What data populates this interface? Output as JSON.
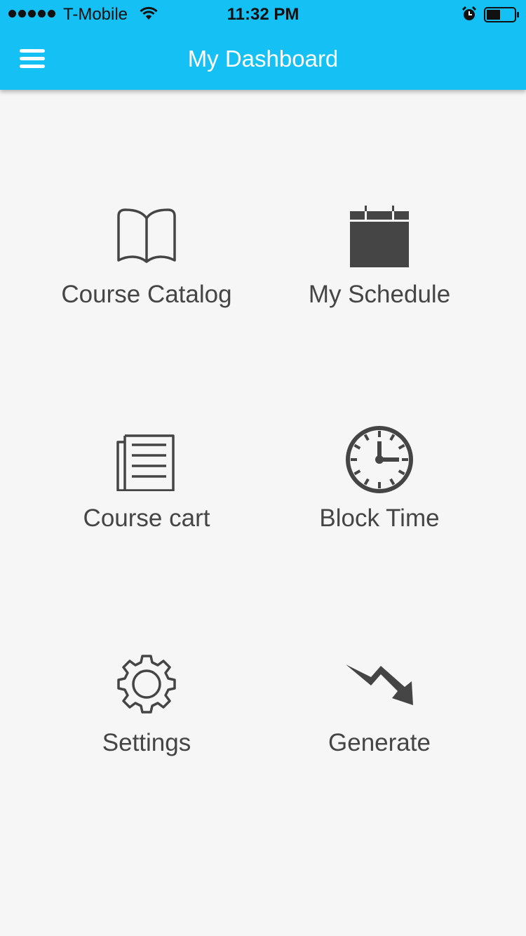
{
  "status_bar": {
    "carrier": "T-Mobile",
    "time": "11:32 PM",
    "signal_bars": 5,
    "battery_level": 0.5,
    "icons": [
      "signal-icon",
      "wifi-icon",
      "alarm-icon",
      "battery-icon"
    ]
  },
  "header": {
    "title": "My Dashboard",
    "menu_icon": "hamburger-menu-icon",
    "background_color": "#14c0f4"
  },
  "dashboard": {
    "items": [
      {
        "label": "Course Catalog",
        "icon": "book-icon"
      },
      {
        "label": "My Schedule",
        "icon": "calendar-icon"
      },
      {
        "label": "Course cart",
        "icon": "document-list-icon"
      },
      {
        "label": "Block Time",
        "icon": "clock-icon"
      },
      {
        "label": "Settings",
        "icon": "gear-icon"
      },
      {
        "label": "Generate",
        "icon": "trend-arrow-icon"
      }
    ]
  },
  "colors": {
    "accent": "#14c0f4",
    "icon_color": "#454545",
    "background": "#f6f6f6"
  }
}
